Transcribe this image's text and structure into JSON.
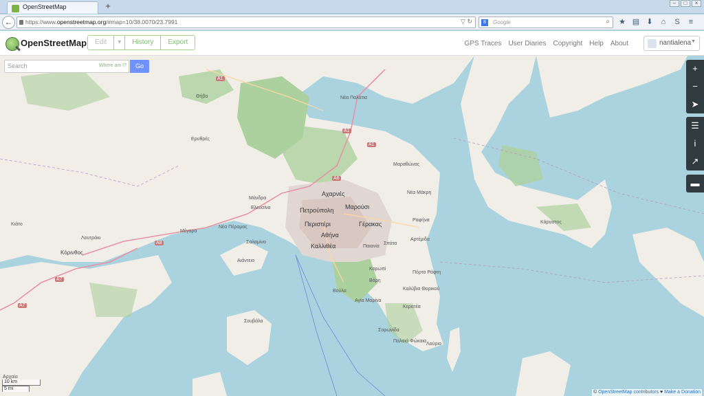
{
  "browser": {
    "tab_title": "OpenStreetMap",
    "new_tab": "+",
    "url_prefix": "https://www.",
    "url_host": "openstreetmap.org",
    "url_path": "/#map=10/38.0070/23.7991",
    "search_placeholder": "Google",
    "search_engine_letter": "8"
  },
  "osm": {
    "brand": "OpenStreetMap",
    "buttons": {
      "edit": "Edit",
      "edit_caret": "▾",
      "history": "History",
      "export": "Export"
    },
    "nav": [
      "GPS Traces",
      "User Diaries",
      "Copyright",
      "Help",
      "About"
    ],
    "user": "nantialena",
    "search_placeholder": "Search",
    "where_am_i": "Where am I?",
    "go": "Go"
  },
  "map_labels": [
    {
      "name": "Θήβα",
      "cls": ""
    },
    {
      "name": "Ερυθρές",
      "cls": ""
    },
    {
      "name": "Νέα Παλάτια",
      "cls": ""
    },
    {
      "name": "Μαραθώνας",
      "cls": ""
    },
    {
      "name": "Αχαρνές",
      "cls": "big"
    },
    {
      "name": "Μάνδρα",
      "cls": ""
    },
    {
      "name": "Ελευσίνα",
      "cls": ""
    },
    {
      "name": "Πετρούπολη",
      "cls": "big"
    },
    {
      "name": "Μαρούσι",
      "cls": "big"
    },
    {
      "name": "Νέα Μάκρη",
      "cls": ""
    },
    {
      "name": "Κάρυστος",
      "cls": ""
    },
    {
      "name": "Κιάτο",
      "cls": ""
    },
    {
      "name": "Λουτράκι",
      "cls": ""
    },
    {
      "name": "Μέγαρα",
      "cls": ""
    },
    {
      "name": "Νέα Πέραμος",
      "cls": ""
    },
    {
      "name": "Περιστέρι",
      "cls": "big"
    },
    {
      "name": "Γέρακας",
      "cls": "big"
    },
    {
      "name": "Ραφήνα",
      "cls": ""
    },
    {
      "name": "Σαλαμίνα",
      "cls": ""
    },
    {
      "name": "Αθήνα",
      "cls": "big"
    },
    {
      "name": "Καλλιθέα",
      "cls": "big"
    },
    {
      "name": "Παιανία",
      "cls": ""
    },
    {
      "name": "Σπάτα",
      "cls": ""
    },
    {
      "name": "Αρτέμιδα",
      "cls": ""
    },
    {
      "name": "Κόρινθος",
      "cls": "med"
    },
    {
      "name": "Αιάντειο",
      "cls": ""
    },
    {
      "name": "Κορωπί",
      "cls": ""
    },
    {
      "name": "Πόρτο Ράφτη",
      "cls": ""
    },
    {
      "name": "Βάρη",
      "cls": ""
    },
    {
      "name": "Βούλα",
      "cls": ""
    },
    {
      "name": "Αγία Μαρίνα",
      "cls": ""
    },
    {
      "name": "Καλύβια Θορικού",
      "cls": ""
    },
    {
      "name": "Κερατέα",
      "cls": ""
    },
    {
      "name": "Σουβάλα",
      "cls": ""
    },
    {
      "name": "Σαρωνίδα",
      "cls": ""
    },
    {
      "name": "Παλαιά Φώκαια",
      "cls": ""
    },
    {
      "name": "Λαύριο",
      "cls": ""
    },
    {
      "name": "Αρχαία",
      "cls": ""
    }
  ],
  "road_shields": [
    "A1",
    "A1",
    "A1",
    "A6",
    "A8",
    "A7",
    "A7"
  ],
  "controls": {
    "zoom_in": "+",
    "zoom_out": "−",
    "locate": "➤",
    "layers": "☰",
    "info": "i",
    "share": "↗",
    "note": "▬"
  },
  "scale": {
    "km": "10 km",
    "mi": "5 mi"
  },
  "attribution": {
    "prefix": "© ",
    "link": "OpenStreetMap contributors",
    "heart": " ♥ ",
    "donate": "Make a Donation"
  },
  "colors": {
    "sea": "#aad3df",
    "land": "#f1eee8",
    "forest": "#add19e",
    "urban": "#e0d7d3",
    "accent": "#7ebc6f",
    "go": "#7092ff"
  }
}
